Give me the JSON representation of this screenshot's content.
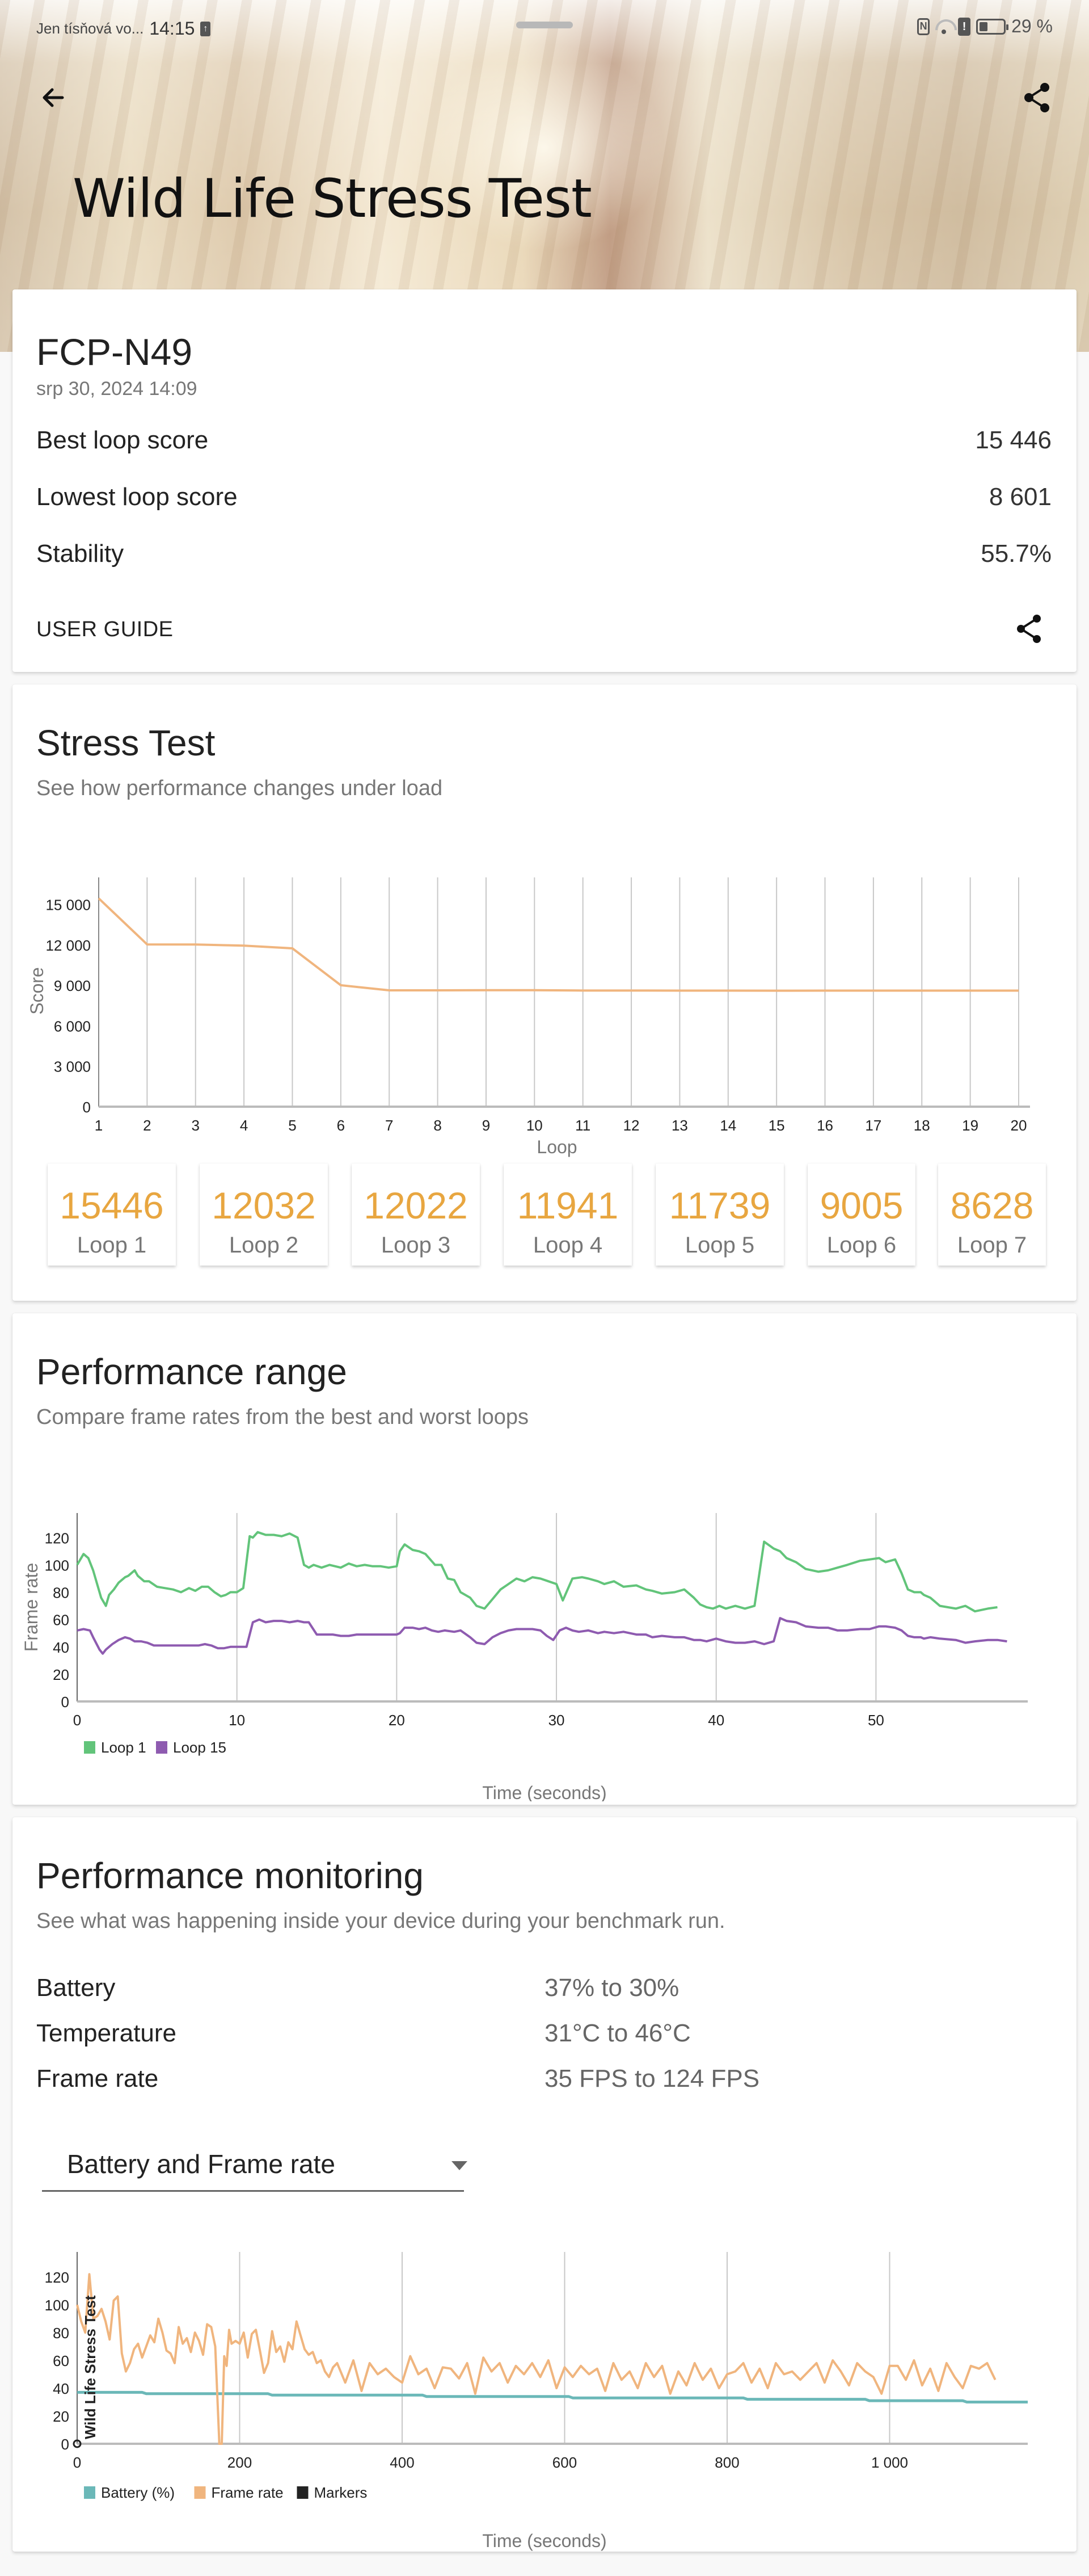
{
  "status_bar": {
    "carrier": "Jen tísňová vo...",
    "time": "14:15",
    "upload_icon": "upload-arrow-icon",
    "icons": [
      "nfc-icon",
      "wifi-icon",
      "sim-alert-icon",
      "battery-icon"
    ],
    "battery_percent": "29 %"
  },
  "header": {
    "title": "Wild Life Stress Test",
    "back_icon": "arrow-left-icon",
    "share_icon": "share-icon"
  },
  "summary": {
    "device": "FCP-N49",
    "date": "srp 30, 2024 14:09",
    "rows": [
      {
        "label": "Best loop score",
        "value": "15 446"
      },
      {
        "label": "Lowest loop score",
        "value": "8 601"
      },
      {
        "label": "Stability",
        "value": "55.7%"
      }
    ],
    "user_guide_label": "USER GUIDE",
    "share_icon": "share-icon"
  },
  "stress_test": {
    "title": "Stress Test",
    "subtitle": "See how performance changes under load",
    "tiles": [
      {
        "score": "15446",
        "label": "Loop 1"
      },
      {
        "score": "12032",
        "label": "Loop 2"
      },
      {
        "score": "12022",
        "label": "Loop 3"
      },
      {
        "score": "11941",
        "label": "Loop 4"
      },
      {
        "score": "11739",
        "label": "Loop 5"
      },
      {
        "score": "9005",
        "label": "Loop 6"
      },
      {
        "score": "8628",
        "label": "Loop 7"
      }
    ]
  },
  "performance_range": {
    "title": "Performance range",
    "subtitle": "Compare frame rates from the best and worst loops"
  },
  "performance_monitoring": {
    "title": "Performance monitoring",
    "subtitle": "See what was happening inside your device during your benchmark run.",
    "rows": [
      {
        "label": "Battery",
        "value": "37% to 30%"
      },
      {
        "label": "Temperature",
        "value": "31°C to 46°C"
      },
      {
        "label": "Frame rate",
        "value": "35 FPS to 124 FPS"
      }
    ],
    "dropdown_value": "Battery and Frame rate"
  },
  "chart_data": [
    {
      "type": "line",
      "id": "stress",
      "title": "",
      "xlabel": "Loop",
      "ylabel": "Score",
      "x": [
        1,
        2,
        3,
        4,
        5,
        6,
        7,
        8,
        9,
        10,
        11,
        12,
        13,
        14,
        15,
        16,
        17,
        18,
        19,
        20
      ],
      "xticks": [
        "1",
        "2",
        "3",
        "4",
        "5",
        "6",
        "7",
        "8",
        "9",
        "10",
        "11",
        "12",
        "13",
        "14",
        "15",
        "16",
        "17",
        "18",
        "19",
        "20"
      ],
      "yticks": [
        "0",
        "3 000",
        "6 000",
        "9 000",
        "12 000",
        "15 000"
      ],
      "ylim": [
        0,
        17000
      ],
      "grid": "vertical",
      "series": [
        {
          "name": "Score",
          "color": "#f0b57e",
          "values": [
            15446,
            12032,
            12022,
            11941,
            11739,
            9005,
            8628,
            8628,
            8640,
            8640,
            8610,
            8610,
            8605,
            8605,
            8601,
            8605,
            8605,
            8605,
            8605,
            8605
          ]
        }
      ]
    },
    {
      "type": "line",
      "id": "range",
      "xlabel": "Time (seconds)",
      "ylabel": "Frame rate",
      "xticks": [
        "0",
        "10",
        "20",
        "30",
        "40",
        "50"
      ],
      "xlim": [
        0,
        59.5
      ],
      "yticks": [
        "0",
        "20",
        "40",
        "60",
        "80",
        "100",
        "120"
      ],
      "ylim": [
        0,
        138
      ],
      "grid": "vertical",
      "legend": "bottom-left",
      "series": [
        {
          "name": "Loop 1",
          "color": "#62c47a",
          "x": [
            0,
            0.4,
            0.7,
            1,
            1.5,
            1.8,
            2,
            2.3,
            2.6,
            3,
            3.2,
            3.6,
            3.8,
            4.2,
            4.5,
            5,
            5.5,
            6,
            6.5,
            7,
            7.4,
            7.8,
            8.2,
            8.6,
            9,
            9.3,
            9.6,
            10,
            10.4,
            10.8,
            11,
            11.3,
            11.8,
            12.3,
            12.8,
            13.3,
            13.8,
            14.2,
            14.5,
            14.8,
            15.3,
            15.8,
            16.5,
            17,
            17.5,
            18,
            18.5,
            19,
            19.5,
            20,
            20.2,
            20.5,
            21,
            21.4,
            21.8,
            22.4,
            22.8,
            23.2,
            23.6,
            24,
            24.6,
            25,
            25.5,
            26,
            26.5,
            27,
            27.5,
            28,
            28.5,
            29,
            29.5,
            30,
            30.4,
            31,
            31.6,
            32,
            32.6,
            33,
            33.6,
            34.2,
            35,
            35.6,
            36,
            36.6,
            37.4,
            38,
            38.6,
            39,
            39.4,
            39.8,
            40.2,
            40.6,
            41.2,
            41.8,
            42.4,
            43,
            43.6,
            44,
            44.4,
            45,
            45.6,
            46.4,
            47,
            47.6,
            48.2,
            49,
            49.6,
            50.2,
            50.6,
            51.2,
            51.6,
            52,
            52.4,
            52.8,
            53,
            53.4,
            54,
            55,
            55.6,
            56.2,
            57,
            57.6,
            58.2,
            58.8,
            59.4
          ],
          "y": [
            100,
            108,
            105,
            96,
            76,
            70,
            78,
            82,
            87,
            91,
            92,
            96,
            92,
            88,
            88,
            84,
            83,
            82,
            80,
            83,
            81,
            84,
            84,
            80,
            77,
            78,
            80,
            80,
            83,
            121,
            120,
            124,
            122,
            122,
            121,
            123,
            120,
            100,
            98,
            100,
            98,
            100,
            98,
            101,
            99,
            100,
            99,
            99,
            98,
            99,
            110,
            115,
            111,
            110,
            108,
            100,
            100,
            90,
            89,
            80,
            76,
            70,
            68,
            75,
            82,
            86,
            90,
            88,
            91,
            90,
            88,
            86,
            74,
            90,
            91,
            90,
            88,
            86,
            88,
            84,
            85,
            82,
            81,
            79,
            80,
            82,
            76,
            71,
            69,
            68,
            70,
            68,
            70,
            68,
            70,
            117,
            112,
            110,
            105,
            102,
            97,
            95,
            96,
            98,
            100,
            103,
            104,
            105,
            102,
            104,
            94,
            82,
            80,
            80,
            78,
            76,
            70,
            68,
            70,
            66,
            68,
            69
          ],
          "note": "approximate trace"
        },
        {
          "name": "Loop 15",
          "color": "#8e5bb0",
          "x": [
            0,
            0.4,
            0.8,
            1,
            1.4,
            1.6,
            1.8,
            2.2,
            2.6,
            3,
            3.3,
            3.6,
            4,
            4.4,
            4.8,
            5.4,
            6,
            6.6,
            7,
            7.6,
            8,
            8.4,
            8.8,
            9.2,
            9.6,
            10,
            10.3,
            10.6,
            11,
            11.4,
            11.8,
            12.3,
            12.8,
            13.3,
            13.8,
            14.2,
            14.5,
            15,
            15.5,
            16,
            16.5,
            17,
            17.5,
            18,
            18.5,
            19,
            19.5,
            20,
            20.2,
            20.5,
            21,
            21.4,
            21.8,
            22.2,
            22.6,
            23,
            23.6,
            24,
            24.6,
            25,
            25.5,
            26,
            26.5,
            27,
            27.5,
            28,
            28.5,
            29,
            29.4,
            29.8,
            30.2,
            30.6,
            31,
            31.4,
            32,
            32.6,
            33,
            33.6,
            34.2,
            35,
            35.6,
            36,
            36.6,
            37.4,
            38,
            38.6,
            39,
            39.4,
            40,
            40.6,
            41.2,
            41.8,
            42.4,
            43,
            43.6,
            44,
            44.4,
            45,
            45.6,
            46.4,
            47,
            47.6,
            48.2,
            49,
            49.6,
            50.2,
            50.6,
            51.2,
            51.6,
            52,
            52.4,
            52.8,
            53,
            53.4,
            54,
            55,
            55.6,
            56.2,
            57,
            57.6,
            58.2,
            58.8,
            59.4
          ],
          "y": [
            52,
            53,
            52,
            47,
            38,
            35,
            38,
            42,
            45,
            47,
            46,
            44,
            44,
            43,
            41,
            41,
            41,
            41,
            41,
            41,
            42,
            41,
            39,
            39,
            40,
            40,
            40,
            40,
            58,
            60,
            58,
            59,
            59,
            58,
            59,
            58,
            58,
            49,
            49,
            49,
            48,
            48,
            49,
            49,
            49,
            49,
            49,
            49,
            50,
            54,
            54,
            53,
            54,
            52,
            51,
            52,
            51,
            52,
            47,
            43,
            42,
            47,
            50,
            52,
            53,
            53,
            53,
            52,
            48,
            45,
            52,
            54,
            52,
            51,
            52,
            50,
            51,
            50,
            51,
            49,
            49,
            47,
            48,
            47,
            47,
            45,
            45,
            44,
            46,
            44,
            43,
            43,
            44,
            42,
            44,
            61,
            59,
            58,
            55,
            54,
            54,
            52,
            52,
            53,
            53,
            55,
            55,
            54,
            52,
            48,
            47,
            47,
            46,
            47,
            46,
            45,
            43,
            44,
            45,
            45,
            44
          ],
          "note": "approximate trace"
        }
      ]
    },
    {
      "type": "line",
      "id": "monitoring",
      "xlabel": "Time (seconds)",
      "ylabel": "",
      "marker_label": "Wild Life Stress Test",
      "xticks": [
        "0",
        "200",
        "400",
        "600",
        "800",
        "1 000"
      ],
      "xlim": [
        0,
        1170
      ],
      "yticks": [
        "0",
        "20",
        "40",
        "60",
        "80",
        "100",
        "120"
      ],
      "ylim": [
        0,
        138
      ],
      "grid": "vertical",
      "legend": "bottom-left",
      "legend_entries": [
        {
          "name": "Battery (%)",
          "color": "#6bb8b8"
        },
        {
          "name": "Frame rate",
          "color": "#f0b57e"
        },
        {
          "name": "Markers",
          "color": "#222222"
        }
      ],
      "series": [
        {
          "name": "Battery (%)",
          "color": "#6bb8b8",
          "step": true,
          "x": [
            0,
            80,
            85,
            235,
            240,
            425,
            430,
            605,
            610,
            820,
            825,
            970,
            975,
            1090,
            1095,
            1170
          ],
          "y": [
            37,
            37,
            36,
            36,
            35,
            35,
            34,
            34,
            33,
            33,
            32,
            32,
            31,
            31,
            30,
            30
          ]
        },
        {
          "name": "Frame rate",
          "color": "#f0b57e",
          "x": [
            0,
            5,
            10,
            15,
            20,
            25,
            30,
            35,
            40,
            45,
            50,
            55,
            60,
            65,
            70,
            75,
            80,
            85,
            90,
            95,
            100,
            105,
            110,
            115,
            120,
            125,
            130,
            135,
            140,
            145,
            150,
            155,
            160,
            165,
            170,
            175,
            178,
            181,
            184,
            187,
            190,
            195,
            200,
            205,
            210,
            215,
            220,
            225,
            230,
            235,
            240,
            245,
            250,
            255,
            260,
            265,
            270,
            275,
            280,
            285,
            290,
            295,
            300,
            305,
            310,
            315,
            320,
            330,
            340,
            350,
            360,
            370,
            380,
            390,
            400,
            410,
            420,
            430,
            440,
            450,
            460,
            470,
            480,
            490,
            500,
            510,
            520,
            530,
            540,
            550,
            560,
            570,
            580,
            590,
            600,
            610,
            620,
            630,
            640,
            650,
            660,
            670,
            680,
            690,
            700,
            710,
            720,
            730,
            740,
            750,
            760,
            770,
            780,
            790,
            800,
            810,
            820,
            830,
            840,
            850,
            860,
            870,
            880,
            890,
            900,
            910,
            920,
            930,
            940,
            950,
            960,
            970,
            980,
            990,
            1000,
            1010,
            1020,
            1030,
            1040,
            1050,
            1060,
            1070,
            1080,
            1090,
            1100,
            1110,
            1120,
            1130,
            1140,
            1150,
            1160,
            1170
          ],
          "y": [
            100,
            88,
            80,
            122,
            90,
            92,
            97,
            88,
            75,
            103,
            106,
            65,
            52,
            58,
            68,
            72,
            62,
            70,
            78,
            73,
            90,
            80,
            67,
            65,
            58,
            84,
            72,
            76,
            66,
            80,
            74,
            64,
            86,
            84,
            70,
            0,
            0,
            63,
            56,
            82,
            72,
            74,
            72,
            80,
            62,
            79,
            82,
            67,
            51,
            58,
            81,
            66,
            70,
            59,
            73,
            68,
            88,
            78,
            68,
            64,
            66,
            58,
            60,
            52,
            48,
            55,
            58,
            44,
            60,
            38,
            58,
            50,
            54,
            48,
            44,
            63,
            50,
            54,
            40,
            55,
            54,
            47,
            58,
            36,
            62,
            52,
            58,
            44,
            56,
            50,
            58,
            48,
            60,
            40,
            55,
            48,
            56,
            50,
            54,
            38,
            58,
            46,
            52,
            40,
            58,
            48,
            56,
            36,
            52,
            42,
            58,
            46,
            54,
            40,
            50,
            52,
            58,
            44,
            54,
            40,
            58,
            50,
            52,
            46,
            52,
            58,
            44,
            60,
            52,
            42,
            58,
            52,
            48,
            36,
            56,
            56,
            46,
            60,
            42,
            54,
            38,
            58,
            48,
            40,
            56,
            54,
            58,
            46
          ],
          "note": "approximate trace"
        },
        {
          "name": "Markers",
          "color": "#222222",
          "x": [
            0
          ],
          "y": [
            0
          ]
        }
      ]
    }
  ]
}
